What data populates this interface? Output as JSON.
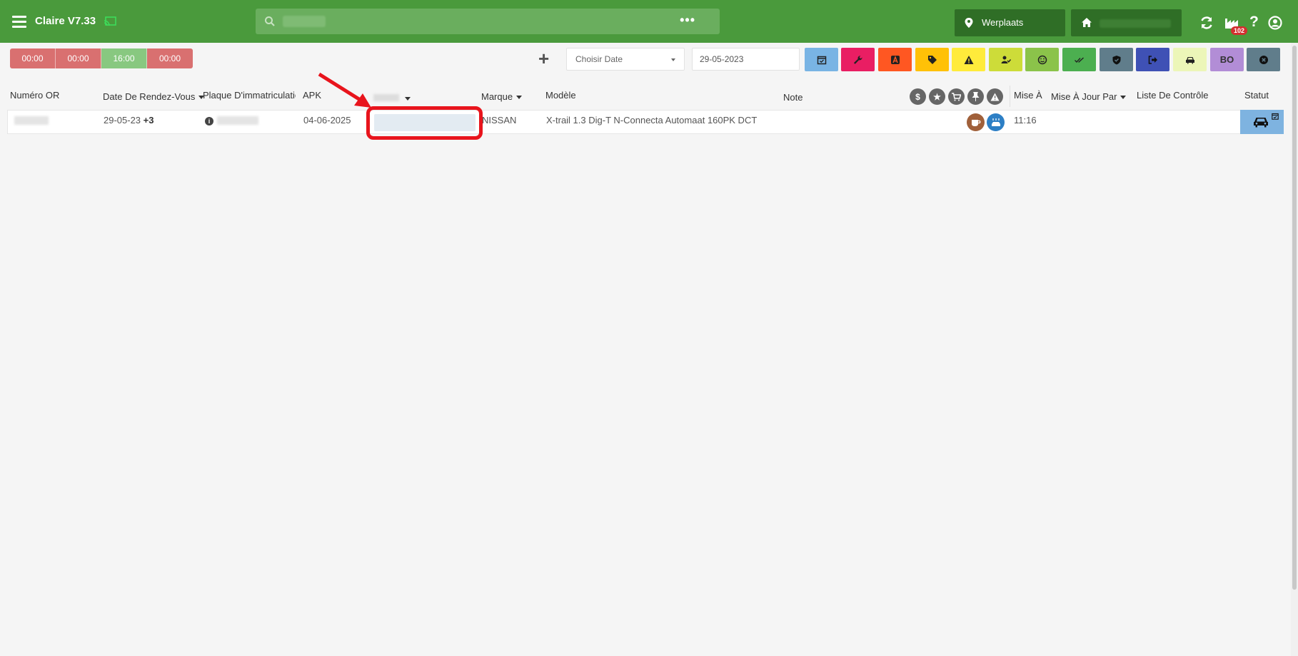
{
  "header": {
    "app_title": "Claire V7.33",
    "location_label": "Werplaats",
    "notification_count": "102",
    "search_more": "•••"
  },
  "toolbar": {
    "times": [
      "00:00",
      "00:00",
      "16:00",
      "00:00"
    ],
    "date_select_placeholder": "Choisir Date",
    "date_value": "29-05-2023",
    "filter_colors": [
      "#79b4e4",
      "#e91e63",
      "#ff5722",
      "#ffc107",
      "#ffeb3b",
      "#cddc39",
      "#8bc34a",
      "#4caf50",
      "#607d8b",
      "#3f51b5",
      "#ecf6b8",
      "#b28dd6",
      "#607d8b"
    ],
    "bo_label": "BO"
  },
  "table": {
    "headers": {
      "numero_or": "Numéro OR",
      "date_rdv": "Date De Rendez-Vous",
      "plaque": "Plaque D'immatriculatio",
      "apk": "APK",
      "marque": "Marque",
      "modele": "Modèle",
      "note": "Note",
      "mise_a": "Mise À",
      "mise_a_jour_par": "Mise À Jour Par",
      "liste_controle": "Liste De Contrôle",
      "statut": "Statut"
    },
    "rows": [
      {
        "date": "29-05-23",
        "date_extra": "+3",
        "apk": "04-06-2025",
        "marque": "NISSAN",
        "modele": "X-trail 1.3 Dig-T N-Connecta Automaat 160PK DCT",
        "time": "11:16"
      }
    ]
  }
}
